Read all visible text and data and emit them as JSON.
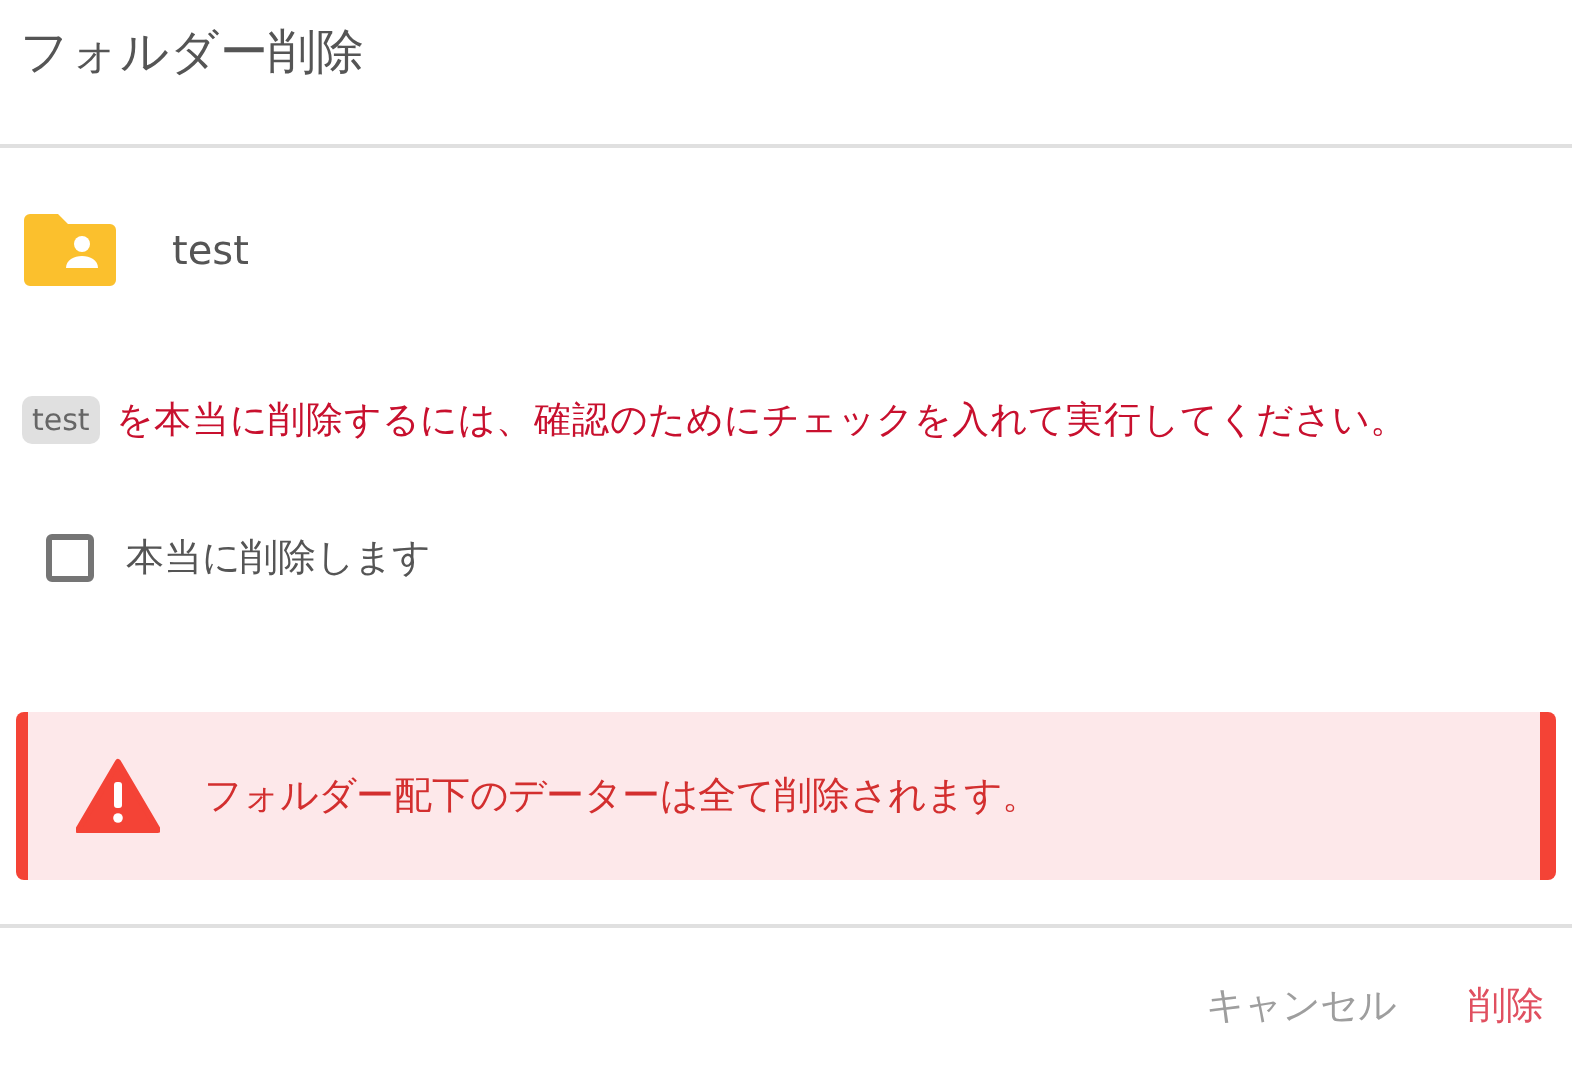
{
  "dialog": {
    "title": "フォルダー削除"
  },
  "folder": {
    "name": "test"
  },
  "confirm": {
    "tag": "test",
    "message": "を本当に削除するには、確認のためにチェックを入れて実行してください。"
  },
  "checkbox": {
    "label": "本当に削除します",
    "checked": false
  },
  "alert": {
    "text": "フォルダー配下のデーターは全て削除されます。"
  },
  "buttons": [
    {
      "label": "キャンセル",
      "kind": "cancel"
    },
    {
      "label": "削除",
      "kind": "danger"
    }
  ]
}
